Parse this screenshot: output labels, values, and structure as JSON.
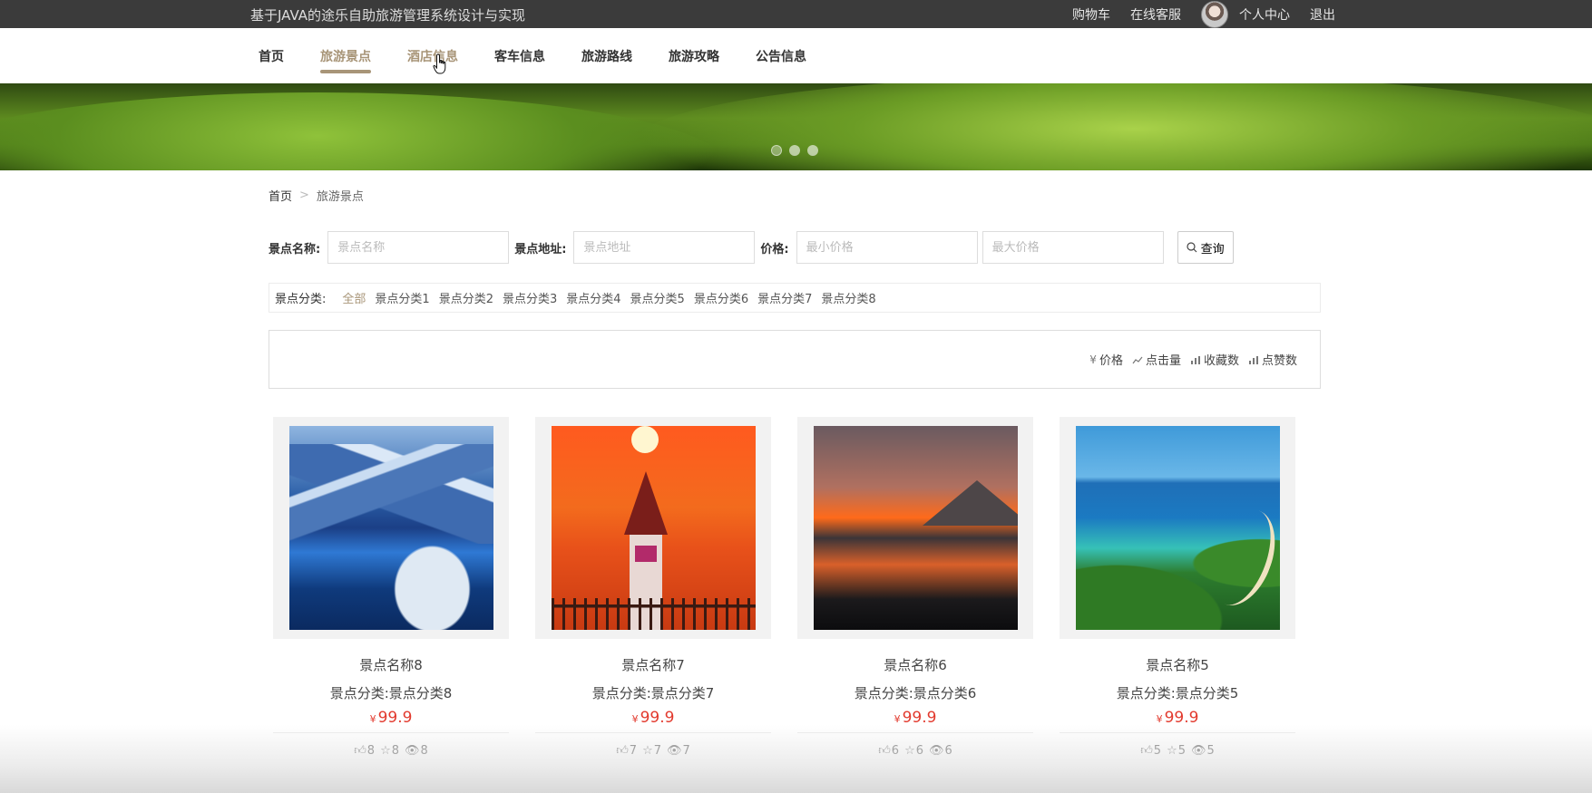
{
  "topbar": {
    "site_title": "基于JAVA的途乐自助旅游管理系统设计与实现",
    "cart": "购物车",
    "service": "在线客服",
    "profile": "个人中心",
    "logout": "退出"
  },
  "nav": {
    "items": [
      {
        "label": "首页"
      },
      {
        "label": "旅游景点"
      },
      {
        "label": "酒店信息"
      },
      {
        "label": "客车信息"
      },
      {
        "label": "旅游路线"
      },
      {
        "label": "旅游攻略"
      },
      {
        "label": "公告信息"
      }
    ],
    "active": "旅游景点"
  },
  "breadcrumb": {
    "home": "首页",
    "separator": ">",
    "current": "旅游景点"
  },
  "search": {
    "name_label": "景点名称:",
    "name_placeholder": "景点名称",
    "address_label": "景点地址:",
    "address_placeholder": "景点地址",
    "price_label": "价格:",
    "min_placeholder": "最小价格",
    "max_placeholder": "最大价格",
    "button": "查询"
  },
  "categories": {
    "label": "景点分类:",
    "items": [
      "全部",
      "景点分类1",
      "景点分类2",
      "景点分类3",
      "景点分类4",
      "景点分类5",
      "景点分类6",
      "景点分类7",
      "景点分类8"
    ],
    "active": "全部"
  },
  "sort": {
    "price": "价格",
    "clicks": "点击量",
    "favorites": "收藏数",
    "likes": "点赞数",
    "price_icon": "¥"
  },
  "cards": [
    {
      "name": "景点名称8",
      "category": "景点分类:景点分类8",
      "currency": "¥",
      "price": "99.9",
      "likes": "8",
      "favorites": "8",
      "views": "8"
    },
    {
      "name": "景点名称7",
      "category": "景点分类:景点分类7",
      "currency": "¥",
      "price": "99.9",
      "likes": "7",
      "favorites": "7",
      "views": "7"
    },
    {
      "name": "景点名称6",
      "category": "景点分类:景点分类6",
      "currency": "¥",
      "price": "99.9",
      "likes": "6",
      "favorites": "6",
      "views": "6"
    },
    {
      "name": "景点名称5",
      "category": "景点分类:景点分类5",
      "currency": "¥",
      "price": "99.9",
      "likes": "5",
      "favorites": "5",
      "views": "5"
    }
  ],
  "colors": {
    "accent": "#a89578",
    "price": "#e23a2e",
    "topbar": "#3b3b3b"
  }
}
